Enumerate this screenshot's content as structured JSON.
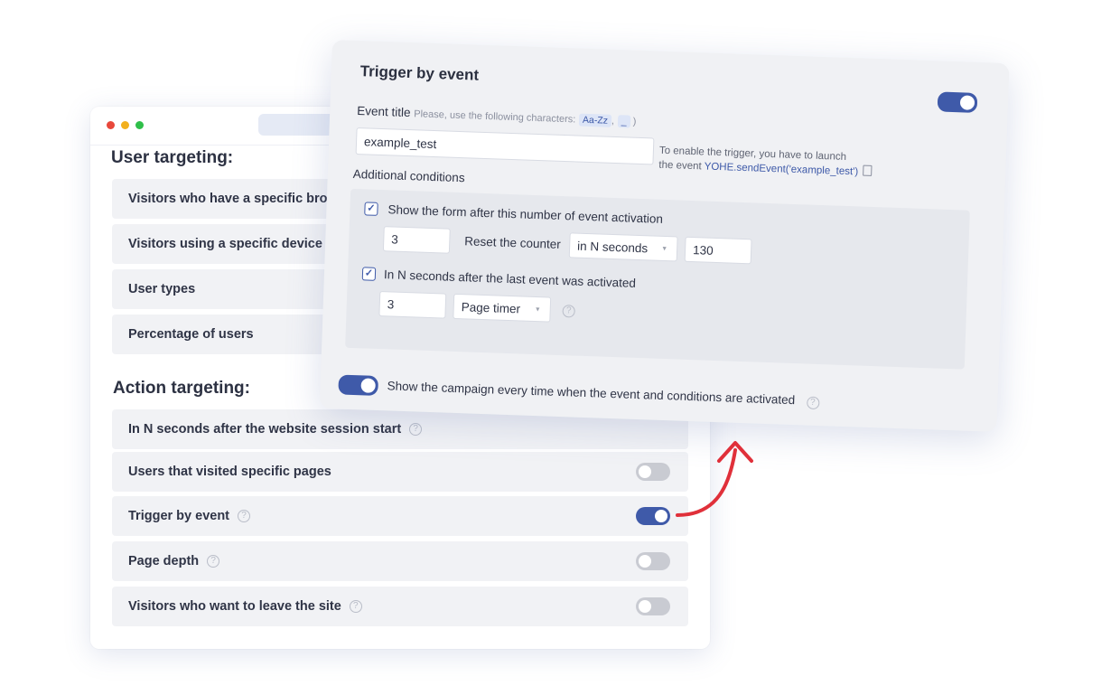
{
  "colors": {
    "accent": "#3f5aa9",
    "arrow": "#e0303a",
    "panel": "#f0f1f4",
    "row": "#f1f2f5"
  },
  "window_dots": [
    "#e8483b",
    "#f2b01e",
    "#2fbf4a"
  ],
  "user_targeting": {
    "title": "User targeting:",
    "items": [
      "Visitors who have a specific brows",
      "Visitors using a specific device",
      "User types",
      "Percentage of users"
    ]
  },
  "action_targeting": {
    "title": "Action targeting:",
    "items": [
      {
        "label": "In N seconds after the website session start",
        "toggle": "hidden"
      },
      {
        "label": "Users that visited specific pages",
        "toggle": "off"
      },
      {
        "label": "Trigger by event",
        "toggle": "on"
      },
      {
        "label": "Page depth",
        "toggle": "off"
      },
      {
        "label": "Visitors who want to leave the site",
        "toggle": "off"
      }
    ]
  },
  "trigger_panel": {
    "title": "Trigger by event",
    "enabled": true,
    "event_title_label": "Event title",
    "event_title_hint": "Please, use the following characters:",
    "allowed_chars": [
      "Aa-Zz",
      "_"
    ],
    "event_title_value": "example_test",
    "enable_note_line1": "To enable the trigger, you have to launch",
    "enable_note_line2_prefix": "the event",
    "enable_note_code": "YOHE.sendEvent('example_test')",
    "additional_conditions_label": "Additional conditions",
    "condition1": {
      "label": "Show the form after this number of event activation",
      "checked": true,
      "count_value": "3",
      "reset_label": "Reset the counter",
      "reset_select": "in N seconds",
      "reset_value": "130"
    },
    "condition2": {
      "label": "In N seconds after the last event was activated",
      "checked": true,
      "seconds_value": "3",
      "timer_select": "Page timer"
    },
    "campaign_label": "Show the campaign every time when the event and conditions are activated",
    "campaign_enabled": true
  }
}
